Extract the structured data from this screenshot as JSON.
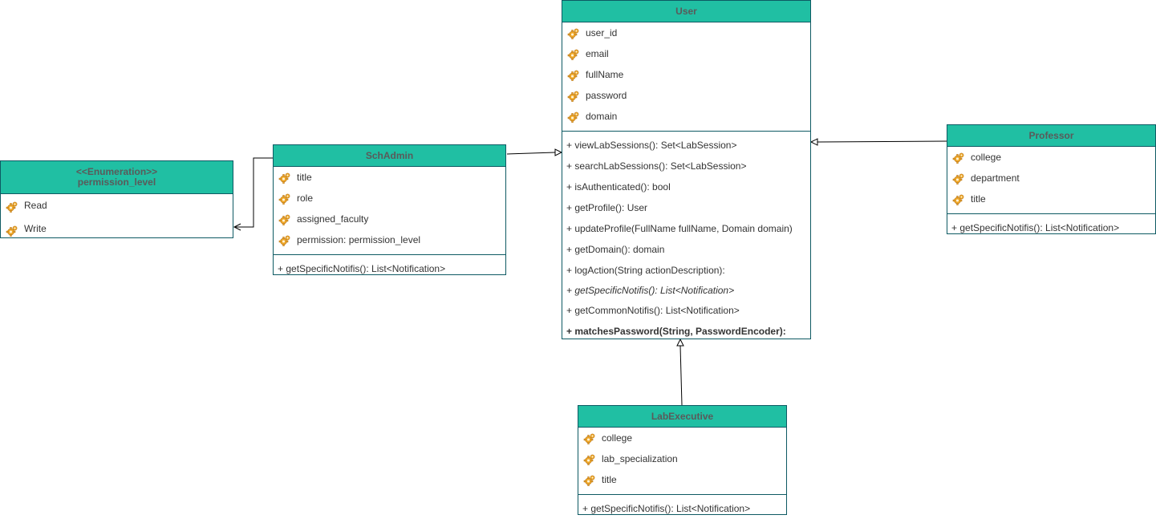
{
  "classes": {
    "user": {
      "name": "User",
      "attributes": [
        "user_id",
        "email",
        "fullName",
        "password",
        "domain"
      ],
      "operations": [
        "+ viewLabSessions(): Set<LabSession>",
        "+ searchLabSessions(): Set<LabSession>",
        "+ isAuthenticated(): bool",
        "+ getProfile(): User",
        "+ updateProfile(FullName fullName, Domain domain)",
        "+ getDomain(): domain",
        "+ logAction(String actionDescription):",
        "+ getSpecificNotifis(): List<Notification>",
        "+ getCommonNotifis(): List<Notification>",
        "+ matchesPassword(String, PasswordEncoder):"
      ]
    },
    "schadmin": {
      "name": "SchAdmin",
      "attributes": [
        "title",
        "role",
        "assigned_faculty",
        "permission: permission_level"
      ],
      "operations": [
        "+ getSpecificNotifis(): List<Notification>"
      ]
    },
    "permission_level": {
      "stereotype": "<<Enumeration>>",
      "name": "permission_level",
      "literals": [
        "Read",
        "Write"
      ]
    },
    "professor": {
      "name": "Professor",
      "attributes": [
        "college",
        "department",
        "title"
      ],
      "operations": [
        "+ getSpecificNotifis(): List<Notification>"
      ]
    },
    "labexecutive": {
      "name": "LabExecutive",
      "attributes": [
        "college",
        "lab_specialization",
        "title"
      ],
      "operations": [
        "+ getSpecificNotifis(): List<Notification>"
      ]
    }
  },
  "colors": {
    "header": "#20bfa3",
    "border": "#0e5a63",
    "text": "#333333"
  },
  "icons": {
    "attribute": "attribute-icon"
  }
}
